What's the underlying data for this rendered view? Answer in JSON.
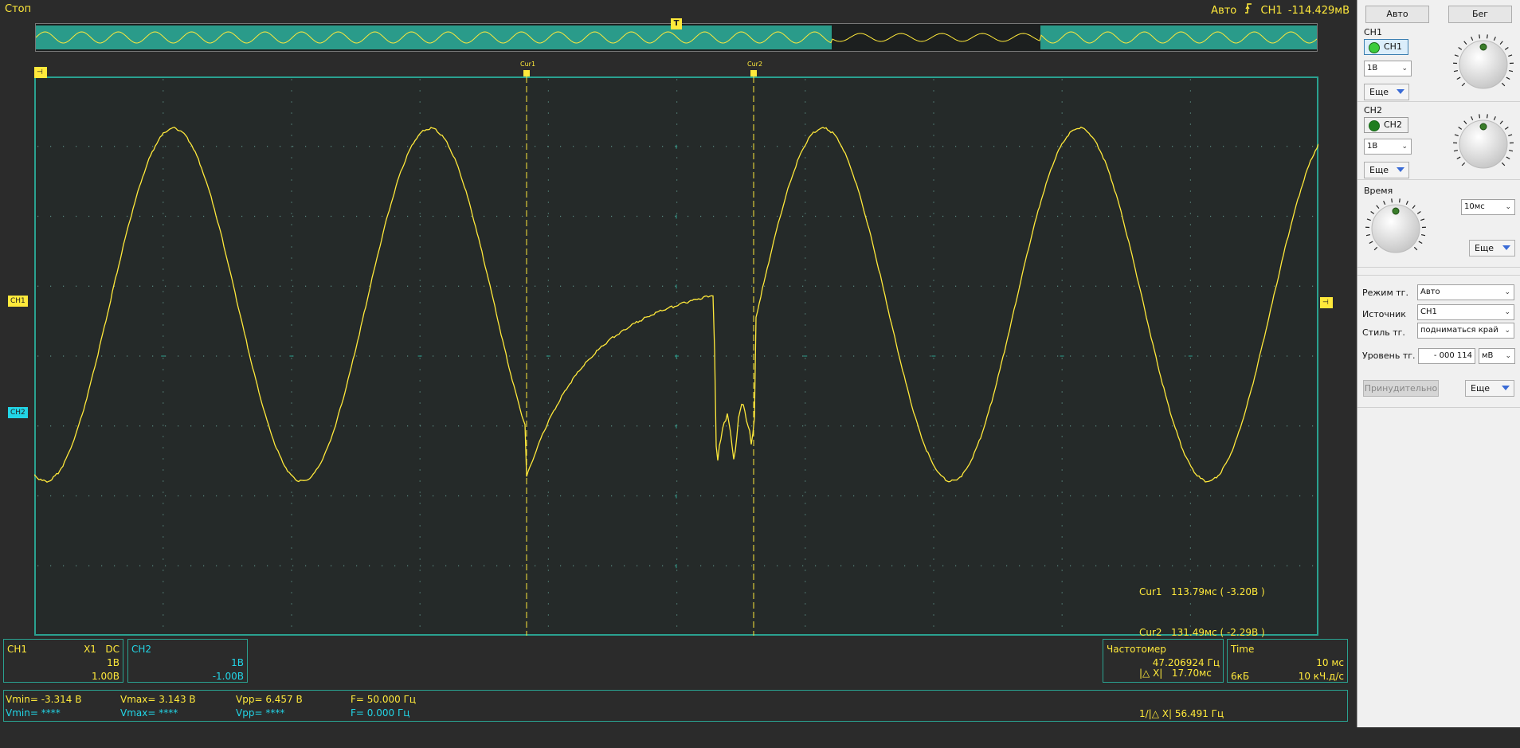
{
  "status": "Стоп",
  "trigger_status": {
    "mode": "Авто",
    "icon": "trigger-edge-icon",
    "channel": "CH1",
    "level": "-114.429мВ"
  },
  "colors": {
    "ch1": "#ffe93b",
    "ch2": "#22d5e6",
    "grid_border": "#2aa190",
    "overview_fill": "#2a9b8a"
  },
  "markers": {
    "ch1": "CH1",
    "ch2": "CH2",
    "trigger_t": "T",
    "cur1": "Cur1",
    "cur2": "Cur2"
  },
  "cursors": {
    "cur1_label": "Cur1",
    "cur1_value": "113.79мс ( -3.20В )",
    "cur2_label": "Cur2",
    "cur2_value": "131.49мс ( -2.29В )",
    "dx_label": "|△ X|",
    "dx_value": "17.70мс",
    "inv_dx_label": "1/|△ X|",
    "inv_dx_value": "56.491 Гц"
  },
  "ch1_panel": {
    "title": "CH1",
    "coupling": "X1   DC",
    "scale": "1В",
    "offset": "1.00В"
  },
  "ch2_panel": {
    "title": "CH2",
    "scale": "1В",
    "offset": "-1.00В"
  },
  "freq_panel": {
    "title": "Частотомер",
    "value": "47.206924 Гц"
  },
  "time_panel": {
    "title": "Time",
    "scale": "10 мс",
    "memory": "6кБ",
    "rate": "10 кЧ.д/с"
  },
  "measurements": {
    "ch1": {
      "vmin": "Vmin= -3.314 В",
      "vmax": "Vmax= 3.143 В",
      "vpp": "Vpp= 6.457 В",
      "f": "F= 50.000 Гц"
    },
    "ch2": {
      "vmin": "Vmin= ****",
      "vmax": "Vmax= ****",
      "vpp": "Vpp= ****",
      "f": "F= 0.000 Гц"
    }
  },
  "controls": {
    "auto_button": "Авто",
    "run_button": "Бег",
    "ch1_group": "CH1",
    "ch1_toggle": "CH1",
    "ch1_scale": "1В",
    "ch1_more": "Еще",
    "ch2_group": "CH2",
    "ch2_toggle": "CH2",
    "ch2_scale": "1В",
    "ch2_more": "Еще",
    "time_group": "Время",
    "time_scale": "10мс",
    "time_more": "Еще",
    "trig_mode_label": "Режим тг.",
    "trig_mode": "Авто",
    "trig_source_label": "Источник",
    "trig_source": "CH1",
    "trig_style_label": "Стиль тг.",
    "trig_style": "подниматься край",
    "trig_level_label": "Уровень тг.",
    "trig_level": "- 000 114",
    "trig_unit": "мВ",
    "force_button": "Принудительно",
    "trig_more": "Еще"
  }
}
